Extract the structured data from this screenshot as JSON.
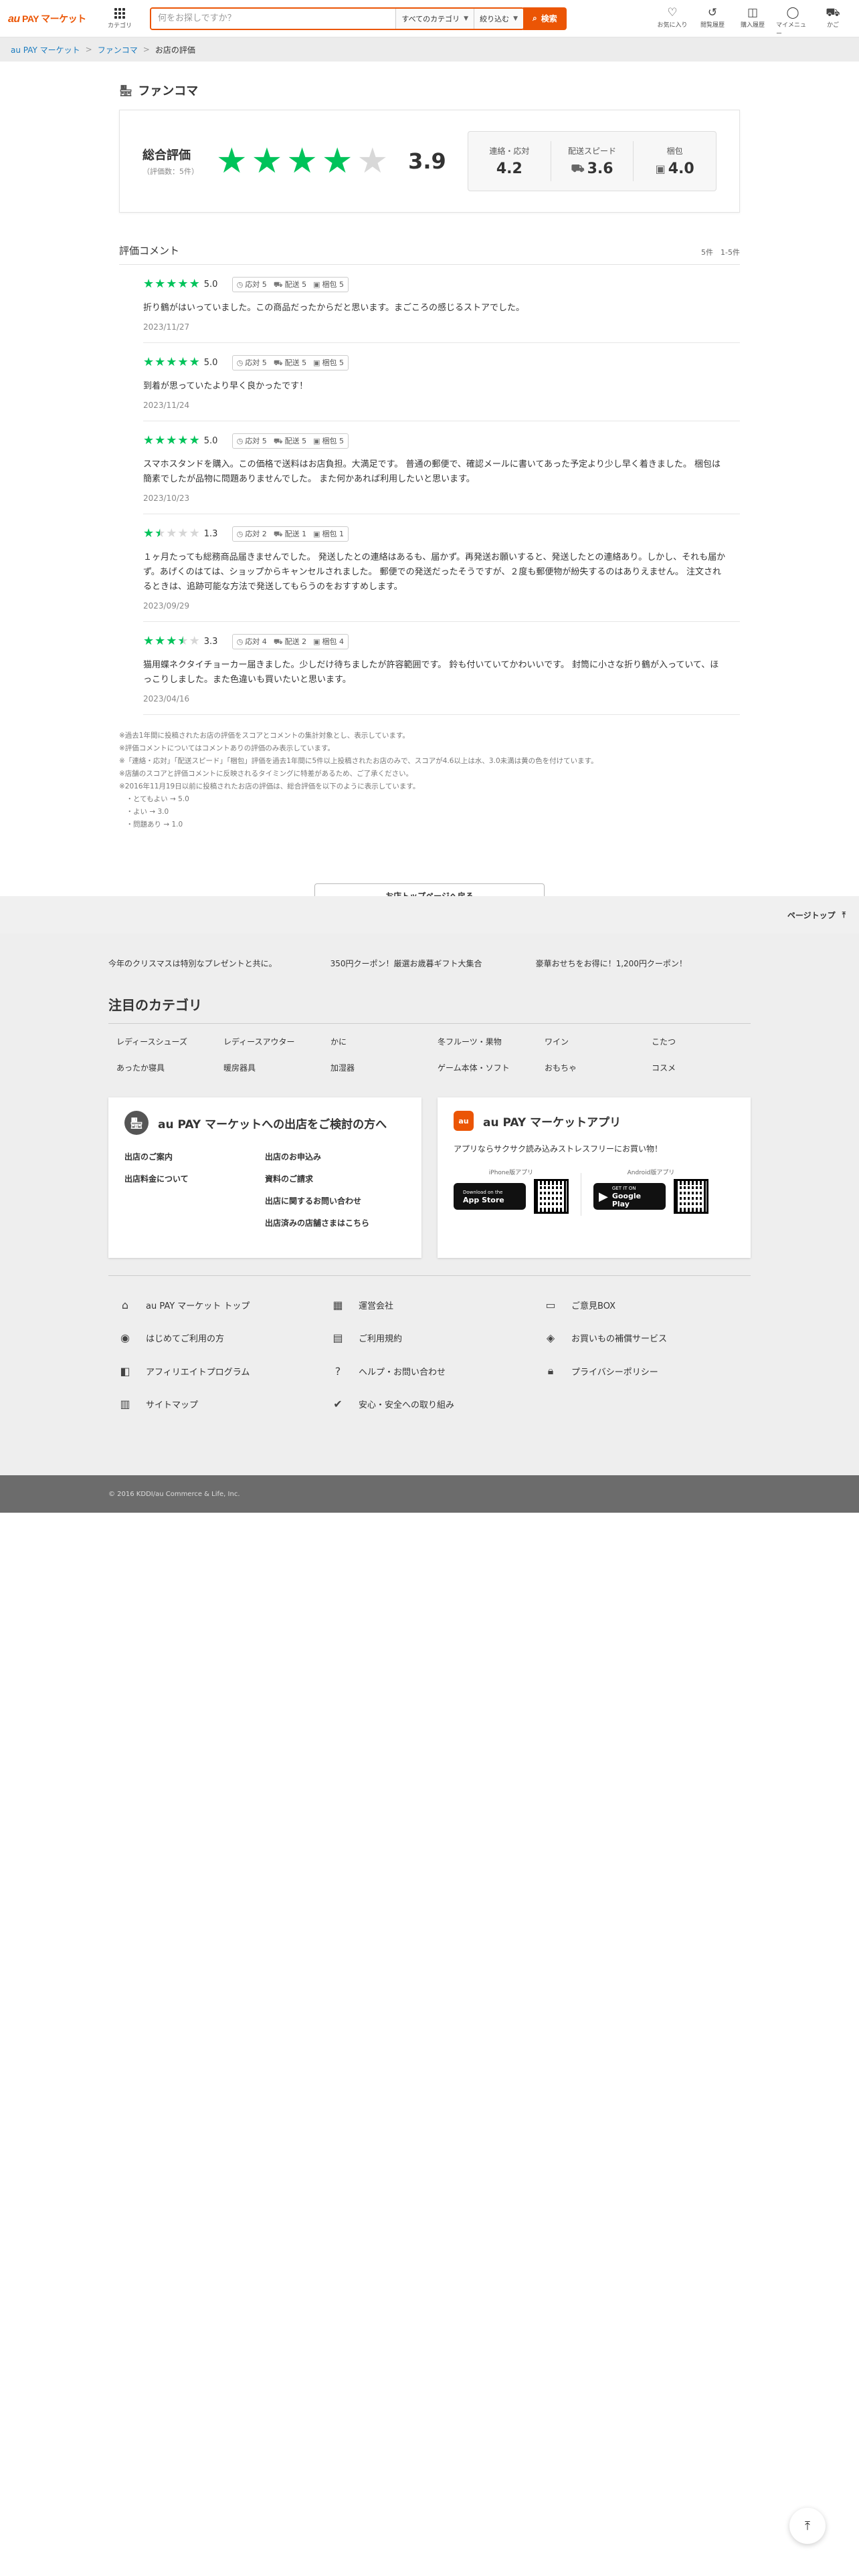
{
  "header": {
    "logo_au": "au",
    "logo_rest": " PAY マーケット",
    "category_label": "カテゴリ",
    "search_placeholder": "何をお探しですか？",
    "category_select": "すべてのカテゴリ",
    "filter_select": "絞り込む",
    "search_button": "検索",
    "icons": [
      {
        "name": "favorite",
        "label": "お気に入り"
      },
      {
        "name": "history",
        "label": "閲覧履歴"
      },
      {
        "name": "orders",
        "label": "購入履歴"
      },
      {
        "name": "mypage",
        "label": "マイメニュー"
      },
      {
        "name": "cart",
        "label": "かご"
      }
    ]
  },
  "breadcrumb": [
    "au PAY マーケット",
    "ファンコマ",
    "お店の評価"
  ],
  "shop": {
    "name": "ファンコマ",
    "overall_label": "総合評価",
    "overall_count": "（評価数：5件）",
    "overall_score": "3.9",
    "overall_stars": 4,
    "sub_scores": [
      {
        "label": "連絡・応対",
        "value": "4.2"
      },
      {
        "label": "配送スピード",
        "value": "3.6"
      },
      {
        "label": "梱包",
        "value": "4.0"
      }
    ]
  },
  "comments": {
    "title": "評価コメント",
    "range": "5件　1-5件",
    "reviews": [
      {
        "stars": 5,
        "score": "5.0",
        "contact": "応対 5",
        "delivery": "配送 5",
        "packing": "梱包 5",
        "text": "折り鶴がはいっていました。この商品だったからだと思います。まごころの感じるストアでした。",
        "date": "2023/11/27"
      },
      {
        "stars": 5,
        "score": "5.0",
        "contact": "応対 5",
        "delivery": "配送 5",
        "packing": "梱包 5",
        "text": "到着が思っていたより早く良かったです！",
        "date": "2023/11/24"
      },
      {
        "stars": 5,
        "score": "5.0",
        "contact": "応対 5",
        "delivery": "配送 5",
        "packing": "梱包 5",
        "text": "スマホスタンドを購入。この価格で送料はお店負担。大満足です。 普通の郵便で、確認メールに書いてあった予定より少し早く着きました。 梱包は簡素でしたが品物に問題ありませんでした。 また何かあれば利用したいと思います。",
        "date": "2023/10/23"
      },
      {
        "stars": 1.5,
        "score": "1.3",
        "contact": "応対 2",
        "delivery": "配送 1",
        "packing": "梱包 1",
        "text": "１ヶ月たっても総務商品届きませんでした。 発送したとの連絡はあるも、届かず。再発送お願いすると、発送したとの連絡あり。しかし、それも届かず。あげくのはては、ショップからキャンセルされました。 郵便での発送だったそうですが、２度も郵便物が紛失するのはありえません。 注文されるときは、追跡可能な方法で発送してもらうのをおすすめします。",
        "date": "2023/09/29"
      },
      {
        "stars": 3.5,
        "score": "3.3",
        "contact": "応対 4",
        "delivery": "配送 2",
        "packing": "梱包 4",
        "text": "猫用蝶ネクタイチョーカー届きました。少しだけ待ちましたが許容範囲です。 鈴も付いていてかわいいです。 封筒に小さな折り鶴が入っていて、ほっこりしました。また色違いも買いたいと思います。",
        "date": "2023/04/16"
      }
    ]
  },
  "notes": [
    "※過去1年間に投稿されたお店の評価をスコアとコメントの集計対象とし、表示しています。",
    "※評価コメントについてはコメントありの評価のみ表示しています。",
    "※「連絡・応対」「配送スピード」「梱包」評価を過去1年間に5件以上投稿されたお店のみで、スコアが4.6以上は水、3.0未満は黄の色を付けています。",
    "※店舗のスコアと評価コメントに反映されるタイミングに特差があるため、ご了承ください。",
    "※2016年11月19日以前に投稿されたお店の評価は、総合評価を以下のように表示しています。",
    "　・とてもよい → 5.0",
    "　・よい → 3.0",
    "　・問題あり → 1.0"
  ],
  "back_button": "お店トップページへ戻る",
  "pagetop": "ページトップ",
  "footer": {
    "promos": [
      "今年のクリスマスは特別なプレゼントと共に。",
      "350円クーポン！厳選お歳暮ギフト大集合",
      "豪華おせちをお得に！1,200円クーポン！"
    ],
    "category_title": "注目のカテゴリ",
    "categories": [
      "レディースシューズ",
      "レディースアウター",
      "かに",
      "冬フルーツ・果物",
      "ワイン",
      "こたつ",
      "あったか寝具",
      "暖房器具",
      "加湿器",
      "ゲーム本体・ソフト",
      "おもちゃ",
      "コスメ"
    ],
    "seller_card": {
      "title": "au PAY マーケットへの出店をご検討の方へ",
      "links": [
        "出店のご案内",
        "出店のお申込み",
        "出店料金について",
        "資料のご請求",
        "",
        "出店に関するお問い合わせ",
        "",
        "出店済みの店舗さまはこちら"
      ]
    },
    "app_card": {
      "icon_text": "au",
      "title": "au PAY マーケットアプリ",
      "subtitle": "アプリならサクサク読み込みストレスフリーにお買い物！",
      "iphone_caption": "iPhone版アプリ",
      "android_caption": "Android版アプリ",
      "appstore_small": "Download on the",
      "appstore": "App Store",
      "googleplay_small": "GET IT ON",
      "googleplay": "Google Play"
    },
    "links": [
      {
        "icon": "home-icon",
        "label": "au PAY マーケット トップ"
      },
      {
        "icon": "building-icon",
        "label": "運営会社"
      },
      {
        "icon": "chat-icon",
        "label": "ご意見BOX"
      },
      {
        "icon": "compass-icon",
        "label": "はじめてご利用の方"
      },
      {
        "icon": "document-icon",
        "label": "ご利用規約"
      },
      {
        "icon": "shield-bag-icon",
        "label": "お買いもの補償サービス"
      },
      {
        "icon": "affiliate-icon",
        "label": "アフィリエイトプログラム"
      },
      {
        "icon": "help-icon",
        "label": "ヘルプ・お問い合わせ"
      },
      {
        "icon": "lock-icon",
        "label": "プライバシーポリシー"
      },
      {
        "icon": "map-icon",
        "label": "サイトマップ"
      },
      {
        "icon": "shield-check-icon",
        "label": "安心・安全への取り組み"
      }
    ],
    "copyright": "© 2016 KDDI/au Commerce & Life, Inc."
  },
  "colors": {
    "accent": "#eb5505",
    "star": "#00c35a",
    "link": "#1a7bbf"
  }
}
